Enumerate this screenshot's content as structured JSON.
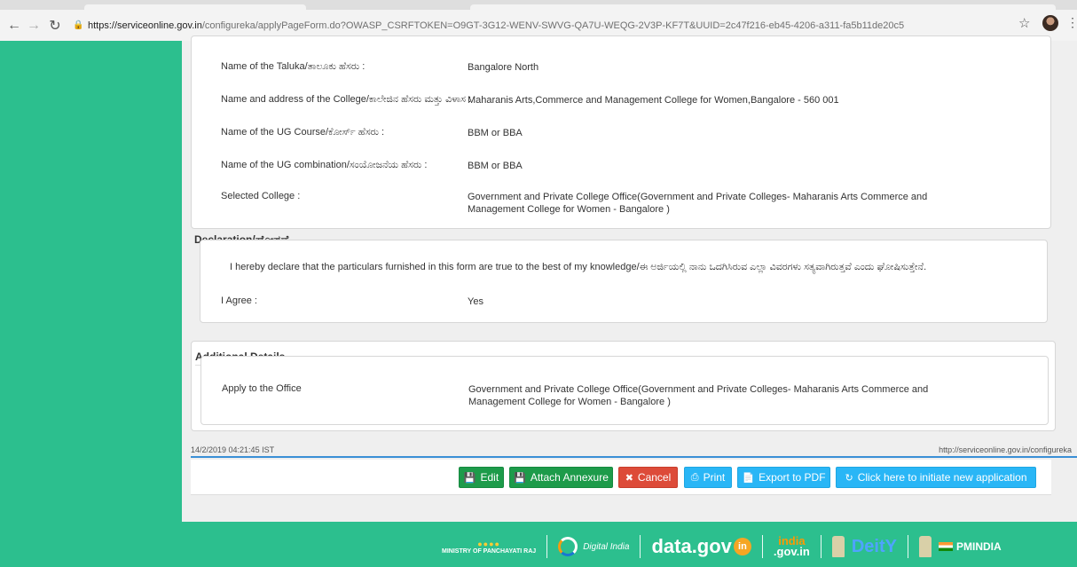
{
  "browser": {
    "url_host": "https://serviceonline.gov.in",
    "url_path": "/configureka/applyPageForm.do?OWASP_CSRFTOKEN=O9GT-3G12-WENV-SWVG-QA7U-WEQG-2V3P-KF7T&UUID=2c47f216-eb45-4206-a311-fa5b11de20c5"
  },
  "details": {
    "taluka_label": "Name of the Taluka/ತಾಲೂಕು ಹೆಸರು :",
    "taluka_value": "Bangalore North",
    "college_label": "Name and address of the College/ಕಾಲೇಜಿನ ಹೆಸರು ಮತ್ತು ವಿಳಾಸ :",
    "college_value": "Maharanis Arts,Commerce and Management College for Women,Bangalore - 560 001",
    "course_label": "Name of the UG Course/ಕೋರ್ಸ್ ಹೆಸರು :",
    "course_value": "BBM or BBA",
    "combination_label": "Name of the UG combination/ಸಂಯೋಜನೆಯ ಹೆಸರು :",
    "combination_value": "BBM or BBA",
    "selected_label": "Selected College :",
    "selected_value": "Government and Private College Office(Government and Private Colleges- Maharanis Arts Commerce and Management College for Women - Bangalore )"
  },
  "declaration": {
    "legend": "Declaration/ಘೋಷಣೆ",
    "text": "I hereby declare that the particulars furnished in this form are true to the best of my knowledge/ಈ ಅರ್ಜಿಯಲ್ಲಿ ನಾನು ಒದಗಿಸಿರುವ ಎಲ್ಲಾ ವಿವರಗಳು ಸತ್ಯವಾಗಿರುತ್ತವೆ ಎಂದು ಘೋಷಿಸುತ್ತೇನೆ.",
    "agree_label": "I Agree :",
    "agree_value": "Yes"
  },
  "additional": {
    "legend": "Additional Details",
    "office_label": "Apply to the Office",
    "office_value": "Government and Private College Office(Government and Private Colleges- Maharanis Arts Commerce and Management College for Women - Bangalore )"
  },
  "meta": {
    "timestamp": "14/2/2019 04:21:45 IST",
    "site": "http://serviceonline.gov.in/configureka"
  },
  "actions": {
    "edit": "Edit",
    "attach": "Attach Annexure",
    "cancel": "Cancel",
    "print": "Print",
    "export": "Export to PDF",
    "new_app": "Click here to initiate new application"
  },
  "footer": {
    "mopr": "MINISTRY OF PANCHAYATI RAJ",
    "digital_india": "Digital India",
    "datagov": "data.gov",
    "datagov_in": "in",
    "india_top": "india",
    "india_bottom": ".gov.in",
    "deity": "DeitY",
    "pmindia": "PMINDIA"
  },
  "colors": {
    "sidebar_green": "#2cbf8e",
    "btn_green": "#1d9b4a",
    "btn_red": "#dd4b39",
    "btn_cyan": "#29b6f6",
    "rule_blue": "#3a8fd6"
  }
}
